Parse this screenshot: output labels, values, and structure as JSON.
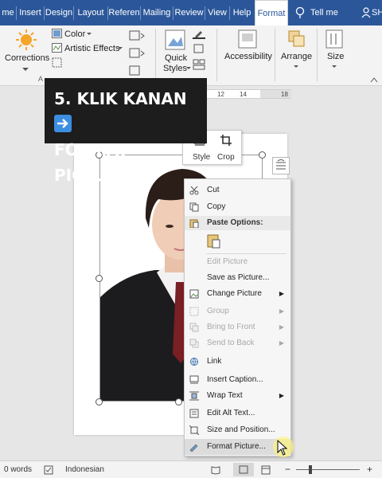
{
  "tabs": [
    "me",
    "Insert",
    "Design",
    "Layout",
    "Referen",
    "Mailing",
    "Review",
    "View",
    "Help",
    "Format"
  ],
  "tell_me": "Tell me",
  "user_initials": "SH",
  "ribbon": {
    "corrections": "Corrections",
    "color": "Color",
    "artistic_effects": "Artistic Effects",
    "quick_styles_line1": "Quick",
    "quick_styles_line2": "Styles",
    "accessibility": "Accessibility",
    "arrange": "Arrange",
    "size": "Size",
    "group_adjust_partial": "A"
  },
  "ruler": {
    "ticks": [
      "12",
      "14",
      "18"
    ]
  },
  "banner": {
    "line1": "5. KLIK KANAN",
    "line2": "FORMAT PICTURE"
  },
  "mini_toolbar": {
    "style": "Style",
    "crop": "Crop"
  },
  "context_menu": {
    "cut": "Cut",
    "copy": "Copy",
    "paste_options": "Paste Options:",
    "edit_picture": "Edit Picture",
    "save_as_picture": "Save as Picture...",
    "change_picture": "Change Picture",
    "group": "Group",
    "bring_to_front": "Bring to Front",
    "send_to_back": "Send to Back",
    "link": "Link",
    "insert_caption": "Insert Caption...",
    "wrap_text": "Wrap Text",
    "edit_alt_text": "Edit Alt Text...",
    "size_and_position": "Size and Position...",
    "format_picture": "Format Picture..."
  },
  "status": {
    "words": "0 words",
    "language": "Indonesian"
  },
  "colors": {
    "ribbon_blue": "#2b579a",
    "banner_bg": "#1d1d1d",
    "arrow_blue": "#3c8ee0"
  }
}
